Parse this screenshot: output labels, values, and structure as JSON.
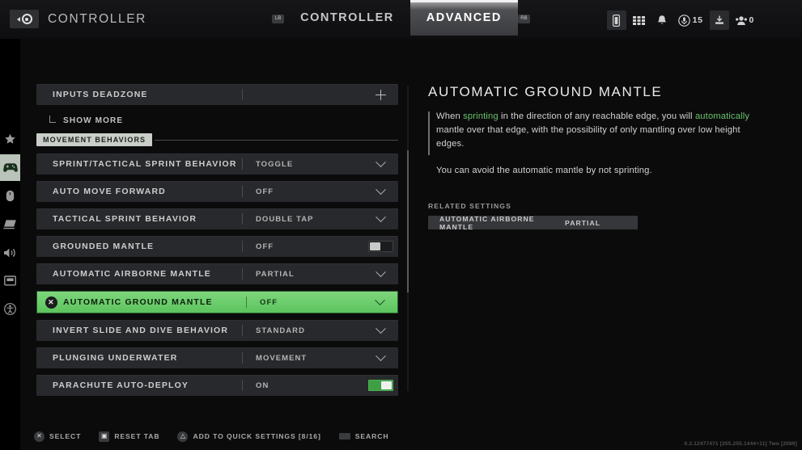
{
  "header": {
    "back_label": "CONTROLLER",
    "back_icon": "back-arrow-circle-icon",
    "tabs": [
      {
        "label": "CONTROLLER",
        "active": false,
        "bumper": "LB"
      },
      {
        "label": "ADVANCED",
        "active": true,
        "bumper": "RB"
      }
    ],
    "status_icons": [
      {
        "name": "battery-icon",
        "value": ""
      },
      {
        "name": "grid-icon",
        "value": ""
      },
      {
        "name": "bell-icon",
        "value": ""
      },
      {
        "name": "microphone-icon",
        "value": "15"
      },
      {
        "name": "download-icon",
        "value": ""
      },
      {
        "name": "friends-icon",
        "value": "0"
      }
    ]
  },
  "sidebar": {
    "items": [
      {
        "name": "star-icon",
        "label": "Favorites",
        "active": false
      },
      {
        "name": "gamepad-icon",
        "label": "Controller",
        "active": true
      },
      {
        "name": "mouse-icon",
        "label": "Mouse",
        "active": false
      },
      {
        "name": "keyboard-icon",
        "label": "Keyboard",
        "active": false
      },
      {
        "name": "speaker-icon",
        "label": "Audio",
        "active": false
      },
      {
        "name": "display-icon",
        "label": "Graphics",
        "active": false
      },
      {
        "name": "accessibility-icon",
        "label": "Accessibility",
        "active": false
      }
    ]
  },
  "settings_list": [
    {
      "kind": "row",
      "label": "INPUTS DEADZONE",
      "value": "",
      "control": "plus",
      "selected": false
    },
    {
      "kind": "sub",
      "label": "SHOW MORE"
    },
    {
      "kind": "section",
      "label": "MOVEMENT BEHAVIORS"
    },
    {
      "kind": "row",
      "label": "SPRINT/TACTICAL SPRINT BEHAVIOR",
      "value": "TOGGLE",
      "control": "chevron",
      "selected": false
    },
    {
      "kind": "row",
      "label": "AUTO MOVE FORWARD",
      "value": "OFF",
      "control": "chevron",
      "selected": false
    },
    {
      "kind": "row",
      "label": "TACTICAL SPRINT BEHAVIOR",
      "value": "DOUBLE TAP",
      "control": "chevron",
      "selected": false
    },
    {
      "kind": "row",
      "label": "GROUNDED MANTLE",
      "value": "OFF",
      "control": "toggle-off",
      "selected": false
    },
    {
      "kind": "row",
      "label": "AUTOMATIC AIRBORNE MANTLE",
      "value": "PARTIAL",
      "control": "chevron",
      "selected": false
    },
    {
      "kind": "row",
      "label": "AUTOMATIC GROUND MANTLE",
      "value": "OFF",
      "control": "chevron",
      "selected": true,
      "action_glyph": "✕"
    },
    {
      "kind": "row",
      "label": "INVERT SLIDE AND DIVE BEHAVIOR",
      "value": "STANDARD",
      "control": "chevron",
      "selected": false
    },
    {
      "kind": "row",
      "label": "PLUNGING UNDERWATER",
      "value": "MOVEMENT",
      "control": "chevron",
      "selected": false
    },
    {
      "kind": "row",
      "label": "PARACHUTE AUTO-DEPLOY",
      "value": "ON",
      "control": "toggle-on",
      "selected": false
    }
  ],
  "detail": {
    "title": "AUTOMATIC GROUND MANTLE",
    "paragraph1_a": "When ",
    "paragraph1_hl1": "sprinting",
    "paragraph1_b": " in the direction of any reachable edge, you will ",
    "paragraph1_hl2": "automatically",
    "paragraph1_c": " mantle over that edge, with the possibility of only mantling over low height edges.",
    "paragraph2": "You can avoid the automatic mantle by not sprinting.",
    "related_heading": "RELATED SETTINGS",
    "related": [
      {
        "label": "AUTOMATIC AIRBORNE MANTLE",
        "value": "PARTIAL"
      }
    ]
  },
  "footer": {
    "hints": [
      {
        "glyph": "✕",
        "shape": "circle",
        "label": "SELECT"
      },
      {
        "glyph": "▣",
        "shape": "square",
        "label": "RESET TAB"
      },
      {
        "glyph": "△",
        "shape": "circle",
        "label": "ADD TO QUICK SETTINGS [8/16]"
      },
      {
        "glyph": "",
        "shape": "bar",
        "label": "SEARCH"
      }
    ],
    "build": "0.3.12477471 [255.255.1444+11] Two [2089]"
  },
  "colors": {
    "accent_green": "#5cc45e",
    "highlight_text": "#67c36a",
    "row_bg": "#28292c",
    "panel_bg": "#0b0b0c"
  }
}
